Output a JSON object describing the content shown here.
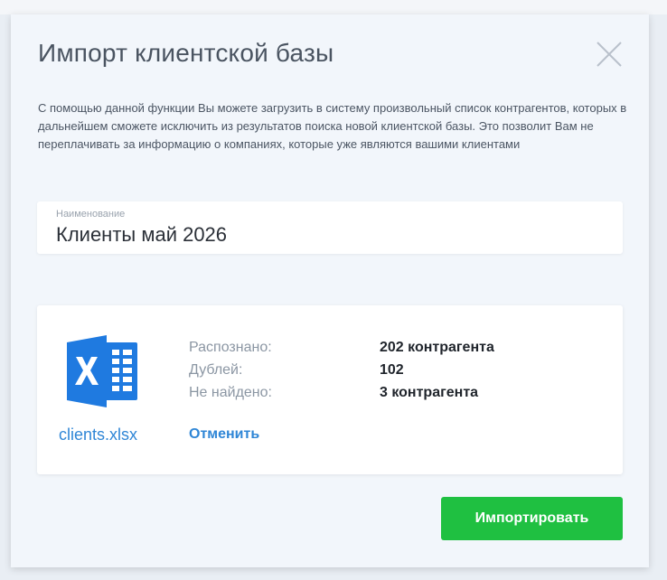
{
  "modal": {
    "title": "Импорт клиентской базы",
    "description": "С помощью данной функции Вы можете загрузить в систему произвольный список контрагентов, которых в дальнейшем сможете исключить из результатов поиска новой клиентской базы. Это позволит Вам не переплачивать за информацию о компаниях, которые уже являются вашими клиентами"
  },
  "name_field": {
    "label": "Наименование",
    "value": "Клиенты май 2026"
  },
  "file": {
    "icon": "excel-file-icon",
    "name": "clients.xlsx",
    "stats": [
      {
        "label": "Распознано:",
        "value": "202 контрагента"
      },
      {
        "label": "Дублей:",
        "value": "102"
      },
      {
        "label": "Не найдено:",
        "value": "3 контрагента"
      }
    ],
    "cancel_label": "Отменить"
  },
  "actions": {
    "import_label": "Импортировать"
  },
  "colors": {
    "accent": "#2f86d6",
    "primary_button": "#1fc041",
    "excel_blue": "#1f7ae0"
  }
}
